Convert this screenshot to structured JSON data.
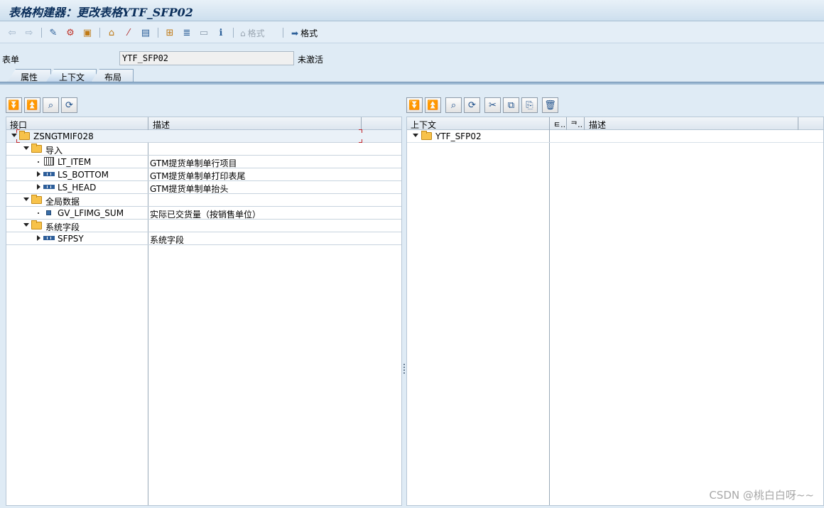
{
  "title": "表格构建器：更改表格YTF_SFP02",
  "toolbar": {
    "format_disabled_label": "格式",
    "format_label": "格式"
  },
  "form": {
    "label": "表单",
    "value": "YTF_SFP02",
    "status": "未激活"
  },
  "tabs": [
    {
      "label": "属性"
    },
    {
      "label": "上下文"
    },
    {
      "label": "布局"
    }
  ],
  "left_grid": {
    "headers": {
      "col1": "接口",
      "col2": "描述"
    },
    "rows": [
      {
        "name": "ZSNGTMIF028",
        "desc": ""
      },
      {
        "name": "导入",
        "desc": ""
      },
      {
        "name": "LT_ITEM",
        "desc": "GTM提货单制单行项目"
      },
      {
        "name": "LS_BOTTOM",
        "desc": "GTM提货单制单打印表尾"
      },
      {
        "name": "LS_HEAD",
        "desc": "GTM提货单制单抬头"
      },
      {
        "name": "全局数据",
        "desc": ""
      },
      {
        "name": "GV_LFIMG_SUM",
        "desc": "实际已交货量（按销售单位）"
      },
      {
        "name": "系统字段",
        "desc": ""
      },
      {
        "name": "SFPSY",
        "desc": "系统字段"
      }
    ]
  },
  "right_grid": {
    "headers": {
      "col1": "上下文",
      "col2": "ㅌ..",
      "col3": "ᄏ..",
      "col4": "描述"
    },
    "rows": [
      {
        "name": "YTF_SFP02",
        "desc": ""
      }
    ]
  },
  "watermark": "CSDN @桃白白呀~~"
}
